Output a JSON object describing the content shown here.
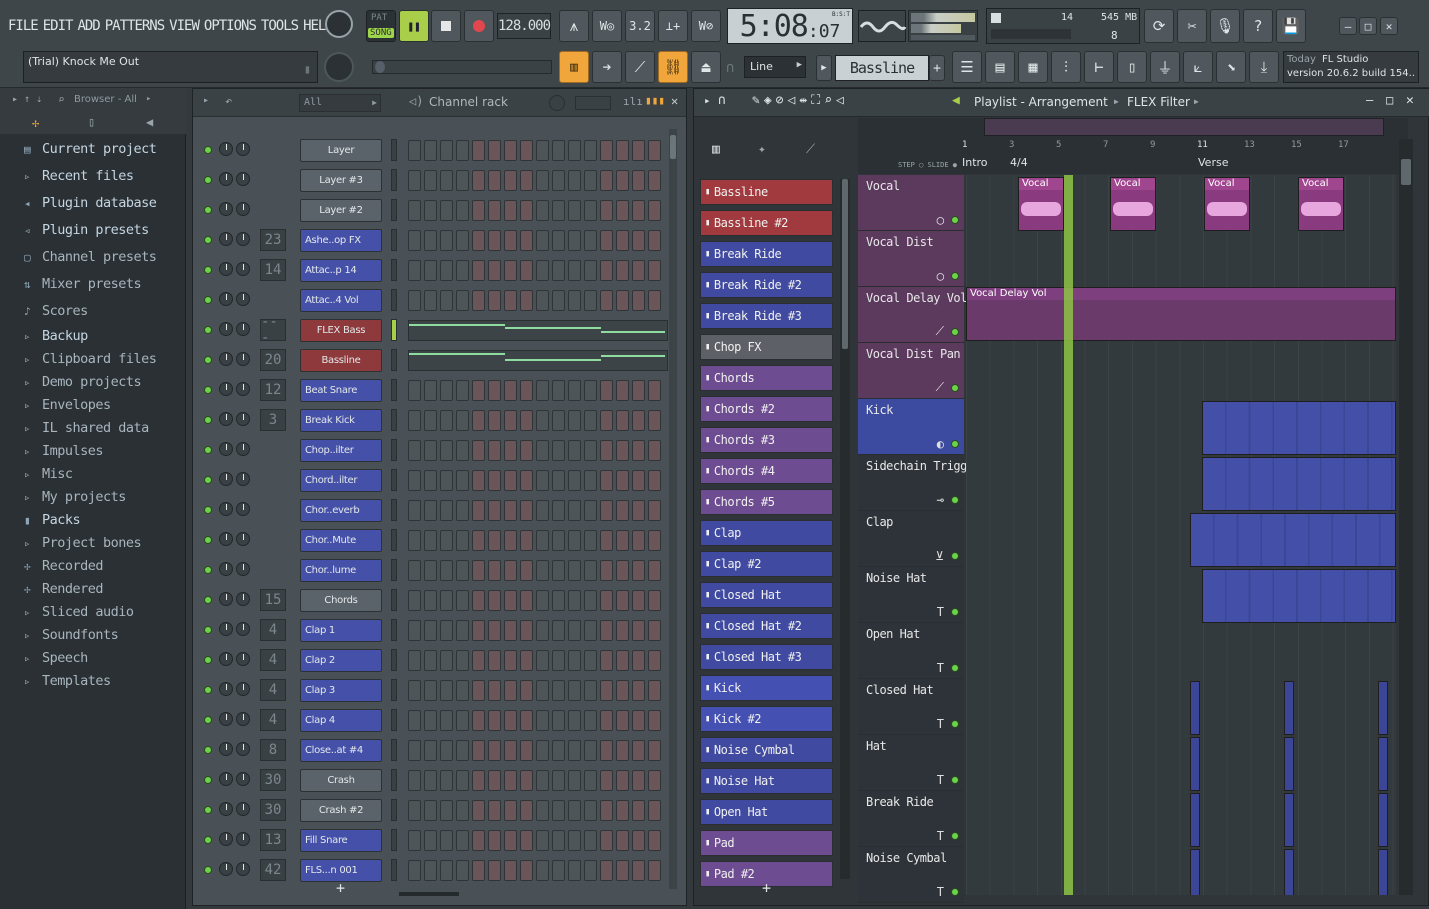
{
  "menu": [
    "FILE",
    "EDIT",
    "ADD",
    "PATTERNS",
    "VIEW",
    "OPTIONS",
    "TOOLS",
    "HELP"
  ],
  "transport": {
    "pat": "PAT",
    "song": "SONG",
    "tempo": "128.000",
    "time": "5:08",
    "time_sub": ":07",
    "bst": "B:S:T"
  },
  "cpu": {
    "voices": "14",
    "mem": "545 MB",
    "poly": "8"
  },
  "hint": {
    "title": "(Trial) Knock Me Out",
    "snap": "Line",
    "pattern": "Bassline",
    "today": "Today",
    "app": "FL Studio",
    "version": "version 20.6.2 build 154.."
  },
  "browser": {
    "title": "Browser - All",
    "items": [
      {
        "label": "Current project",
        "color": "#c4d5e2"
      },
      {
        "label": "Recent files",
        "color": "#c4d5e2"
      },
      {
        "label": "Plugin database",
        "color": "#c4d5e2"
      },
      {
        "label": "Plugin presets",
        "color": "#c4d5e2"
      },
      {
        "label": "Channel presets",
        "color": "#a8b5bd"
      },
      {
        "label": "Mixer presets",
        "color": "#a8b5bd"
      },
      {
        "label": "Scores",
        "color": "#a8b5bd"
      },
      {
        "label": "Backup",
        "color": "#c4d5e2"
      },
      {
        "label": "Clipboard files",
        "color": "#a8b5bd"
      },
      {
        "label": "Demo projects",
        "color": "#a8b5bd"
      },
      {
        "label": "Envelopes",
        "color": "#a8b5bd"
      },
      {
        "label": "IL shared data",
        "color": "#a8b5bd"
      },
      {
        "label": "Impulses",
        "color": "#a8b5bd"
      },
      {
        "label": "Misc",
        "color": "#a8b5bd"
      },
      {
        "label": "My projects",
        "color": "#a8b5bd"
      },
      {
        "label": "Packs",
        "color": "#c4d5e2"
      },
      {
        "label": "Project bones",
        "color": "#a8b5bd"
      },
      {
        "label": "Recorded",
        "color": "#a8b5bd"
      },
      {
        "label": "Rendered",
        "color": "#a8b5bd"
      },
      {
        "label": "Sliced audio",
        "color": "#a8b5bd"
      },
      {
        "label": "Soundfonts",
        "color": "#a8b5bd"
      },
      {
        "label": "Speech",
        "color": "#a8b5bd"
      },
      {
        "label": "Templates",
        "color": "#a8b5bd"
      }
    ]
  },
  "rack": {
    "title": "Channel rack",
    "filter": "All",
    "channels": [
      {
        "name": "Layer",
        "num": "",
        "style": "gray"
      },
      {
        "name": "Layer #3",
        "num": "",
        "style": "gray"
      },
      {
        "name": "Layer #2",
        "num": "",
        "style": "gray"
      },
      {
        "name": "Ashe..op FX",
        "num": "23",
        "style": "blue"
      },
      {
        "name": "Attac..p 14",
        "num": "14",
        "style": "blue"
      },
      {
        "name": "Attac..4 Vol",
        "num": "",
        "style": "blue"
      },
      {
        "name": "FLEX Bass",
        "num": "---",
        "style": "red"
      },
      {
        "name": "Bassline",
        "num": "20",
        "style": "red"
      },
      {
        "name": "Beat Snare",
        "num": "12",
        "style": "blue"
      },
      {
        "name": "Break Kick",
        "num": "3",
        "style": "blue"
      },
      {
        "name": "Chop..ilter",
        "num": "",
        "style": "blue"
      },
      {
        "name": "Chord..ilter",
        "num": "",
        "style": "blue"
      },
      {
        "name": "Chor..everb",
        "num": "",
        "style": "blue"
      },
      {
        "name": "Chor..Mute",
        "num": "",
        "style": "blue"
      },
      {
        "name": "Chor..lume",
        "num": "",
        "style": "blue"
      },
      {
        "name": "Chords",
        "num": "15",
        "style": "gray"
      },
      {
        "name": "Clap 1",
        "num": "4",
        "style": "blue"
      },
      {
        "name": "Clap 2",
        "num": "4",
        "style": "blue"
      },
      {
        "name": "Clap 3",
        "num": "4",
        "style": "blue"
      },
      {
        "name": "Clap 4",
        "num": "4",
        "style": "blue"
      },
      {
        "name": "Close..at #4",
        "num": "8",
        "style": "blue"
      },
      {
        "name": "Crash",
        "num": "30",
        "style": "gray"
      },
      {
        "name": "Crash #2",
        "num": "30",
        "style": "gray"
      },
      {
        "name": "Fill Snare",
        "num": "13",
        "style": "blue"
      },
      {
        "name": "FLS...n 001",
        "num": "42",
        "style": "blue"
      }
    ]
  },
  "playlist": {
    "title": "Playlist - Arrangement",
    "subtitle": "FLEX Filter",
    "patterns": [
      {
        "name": "Bassline",
        "color": "#a03a3e"
      },
      {
        "name": "Bassline #2",
        "color": "#a03a3e"
      },
      {
        "name": "Break Ride",
        "color": "#3f4aa0"
      },
      {
        "name": "Break Ride #2",
        "color": "#3f4aa0"
      },
      {
        "name": "Break Ride #3",
        "color": "#3f4aa0"
      },
      {
        "name": "Chop FX",
        "color": "#5d6066"
      },
      {
        "name": "Chords",
        "color": "#6e4c92"
      },
      {
        "name": "Chords #2",
        "color": "#6e4c92"
      },
      {
        "name": "Chords #3",
        "color": "#6e4c92"
      },
      {
        "name": "Chords #4",
        "color": "#6e4c92"
      },
      {
        "name": "Chords #5",
        "color": "#6e4c92"
      },
      {
        "name": "Clap",
        "color": "#3f4aa0"
      },
      {
        "name": "Clap #2",
        "color": "#3f4aa0"
      },
      {
        "name": "Closed Hat",
        "color": "#3f4aa0"
      },
      {
        "name": "Closed Hat #2",
        "color": "#3f4aa0"
      },
      {
        "name": "Closed Hat #3",
        "color": "#3f4aa0"
      },
      {
        "name": "Kick",
        "color": "#4550b3"
      },
      {
        "name": "Kick #2",
        "color": "#4550b3"
      },
      {
        "name": "Noise Cymbal",
        "color": "#3f4aa0"
      },
      {
        "name": "Noise Hat",
        "color": "#3f4aa0"
      },
      {
        "name": "Open Hat",
        "color": "#3f4aa0"
      },
      {
        "name": "Pad",
        "color": "#6e4c92"
      },
      {
        "name": "Pad #2",
        "color": "#6e4c92"
      }
    ],
    "tracks": [
      "Vocal",
      "Vocal Dist",
      "Vocal Delay Vol",
      "Vocal Dist Pan",
      "Kick",
      "Sidechain Trigger",
      "Clap",
      "Noise Hat",
      "Open Hat",
      "Closed Hat",
      "Hat",
      "Break Ride",
      "Noise Cymbal"
    ],
    "ruler": [
      "1",
      "3",
      "5",
      "7",
      "9",
      "11",
      "13",
      "15",
      "17"
    ],
    "markers": [
      "Intro",
      "4/4",
      "Verse"
    ],
    "clip_vocal": "Vocal",
    "clip_env": "Vocal Delay Vol"
  }
}
